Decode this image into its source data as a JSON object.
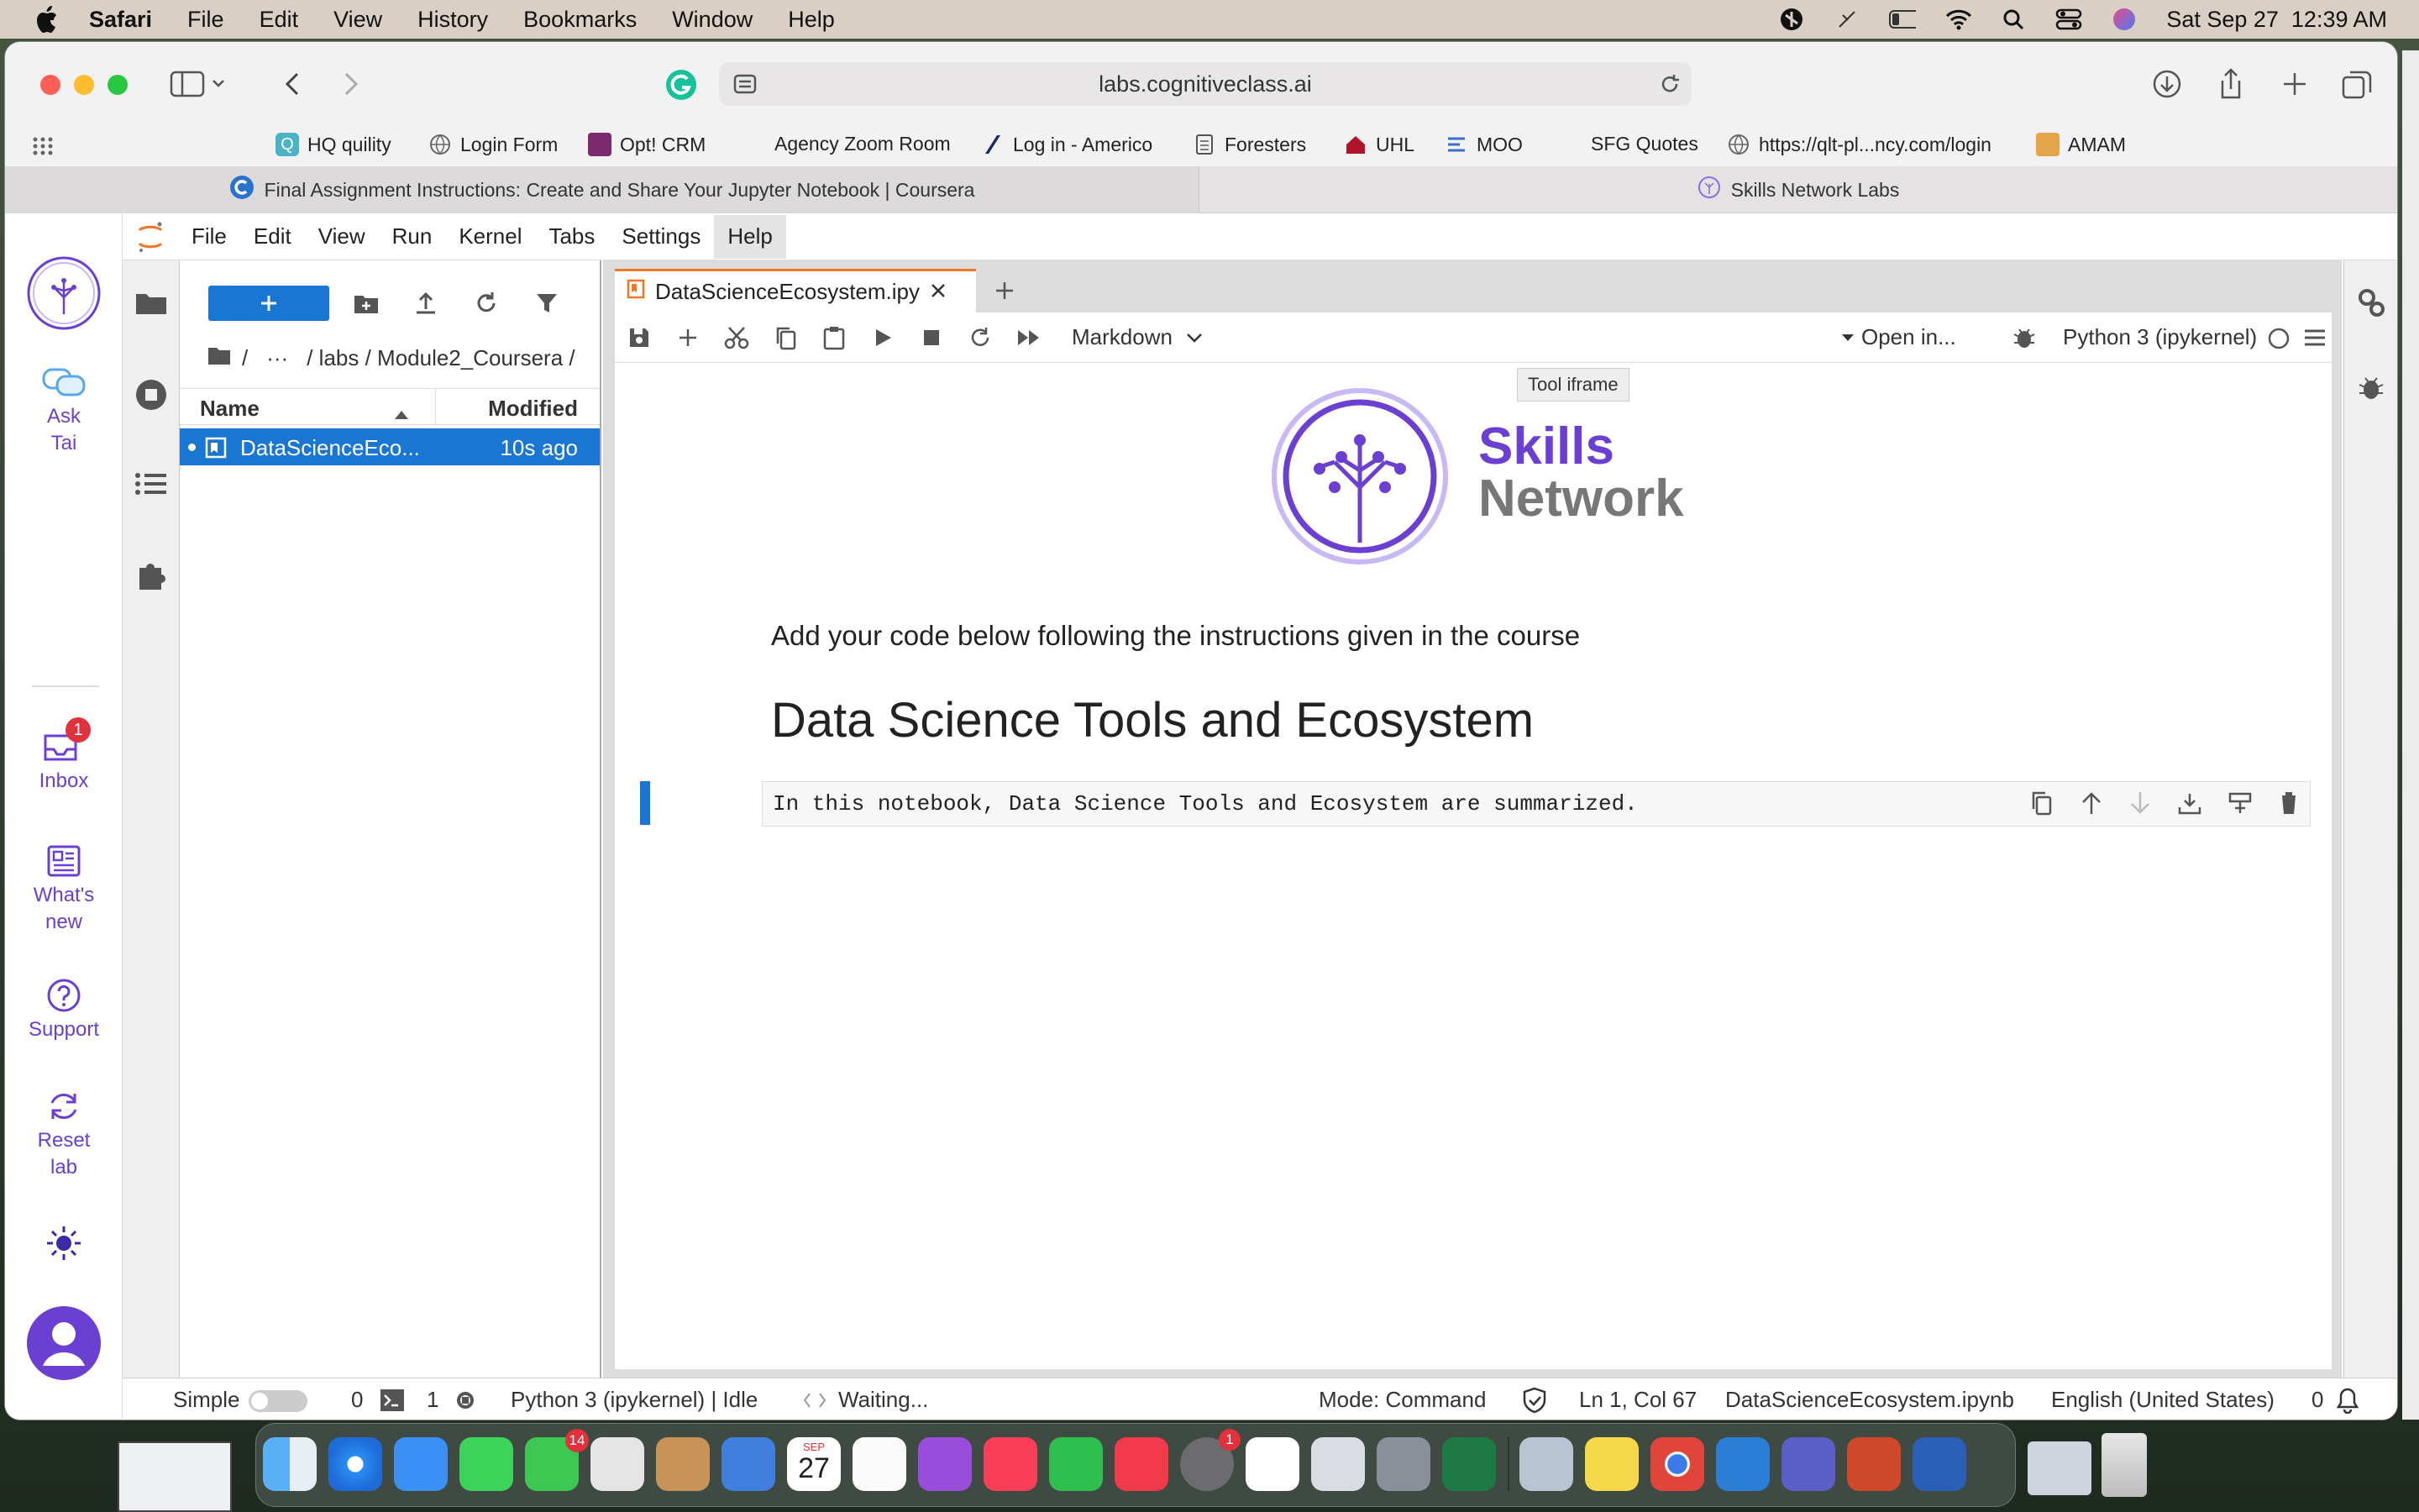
{
  "menubar": {
    "app": "Safari",
    "items": [
      "File",
      "Edit",
      "View",
      "History",
      "Bookmarks",
      "Window",
      "Help"
    ],
    "clock": "Sat Sep 27  12:39 AM"
  },
  "browser": {
    "url": "labs.cognitiveclass.ai",
    "favorites": [
      "HQ quility",
      "Login Form",
      "Opt! CRM",
      "Agency Zoom Room",
      "Log in - Americo",
      "Foresters",
      "UHL",
      "MOO",
      "SFG Quotes",
      "https://qlt-pl...ncy.com/login",
      "AMAM"
    ],
    "tabs": [
      "Final Assignment Instructions: Create and Share Your Jupyter Notebook | Coursera",
      "Skills Network Labs"
    ]
  },
  "sn_sidebar": {
    "ask": "Ask\nTai",
    "inbox": "Inbox",
    "inbox_badge": "1",
    "whats_new": "What's\nnew",
    "support": "Support",
    "reset": "Reset\nlab"
  },
  "jupyter_menu": [
    "File",
    "Edit",
    "View",
    "Run",
    "Kernel",
    "Tabs",
    "Settings",
    "Help"
  ],
  "filebrowser": {
    "path_sep": "/",
    "ellipsis": "···",
    "path": "/ labs / Module2_Coursera /",
    "col_name": "Name",
    "col_modified": "Modified",
    "files": [
      {
        "name": "DataScienceEco...",
        "modified": "10s ago"
      }
    ]
  },
  "notebook": {
    "tab_name": "DataScienceEcosystem.ipy",
    "cell_type": "Markdown",
    "open_in": "Open in...",
    "kernel": "Python 3 (ipykernel)",
    "tooltip": "Tool iframe",
    "logo_line1": "Skills",
    "logo_line2": "Network",
    "intro_text": "Add your code below following the instructions given in the course",
    "heading": "Data Science Tools and Ecosystem",
    "cell_source": "In this notebook, Data Science Tools and Ecosystem are summarized."
  },
  "statusbar": {
    "simple": "Simple",
    "terminals": "0",
    "kernels": "1",
    "kernel_status": "Python 3 (ipykernel) | Idle",
    "waiting": "Waiting...",
    "mode": "Mode: Command",
    "position": "Ln 1, Col 67",
    "file": "DataScienceEcosystem.ipynb",
    "language": "English (United States)",
    "notifications": "0"
  },
  "dock": {
    "facetime_badge": "14",
    "calendar_month": "SEP",
    "calendar_day": "27",
    "settings_badge": "1"
  },
  "colors": {
    "accent": "#6a3fd1",
    "jupyter_blue": "#1976d2",
    "jupyter_orange": "#f37726"
  }
}
